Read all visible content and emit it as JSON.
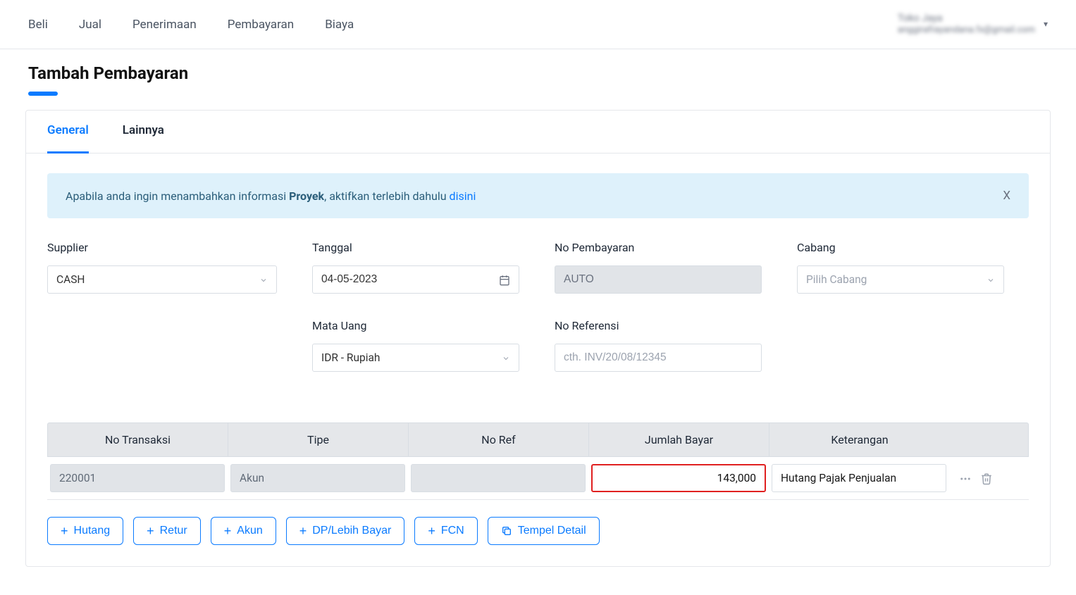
{
  "nav": {
    "items": [
      "Beli",
      "Jual",
      "Penerimaan",
      "Pembayaran",
      "Biaya"
    ]
  },
  "profile": {
    "line1": "Toko Jaya",
    "line2": "anggirafrayandana.fx@gmail.com"
  },
  "page": {
    "title": "Tambah Pembayaran"
  },
  "tabs": {
    "general": "General",
    "other": "Lainnya"
  },
  "banner": {
    "text_pre": "Apabila anda ingin menambahkan informasi ",
    "bold": "Proyek",
    "text_mid": ", aktifkan terlebih dahulu ",
    "link": "disini"
  },
  "form": {
    "supplier": {
      "label": "Supplier",
      "value": "CASH"
    },
    "tanggal": {
      "label": "Tanggal",
      "value": "04-05-2023"
    },
    "no_pembayaran": {
      "label": "No Pembayaran",
      "value": "AUTO"
    },
    "cabang": {
      "label": "Cabang",
      "placeholder": "Pilih Cabang"
    },
    "mata_uang": {
      "label": "Mata Uang",
      "value": "IDR - Rupiah"
    },
    "no_referensi": {
      "label": "No Referensi",
      "placeholder": "cth. INV/20/08/12345"
    }
  },
  "table": {
    "headers": {
      "no_transaksi": "No Transaksi",
      "tipe": "Tipe",
      "no_ref": "No Ref",
      "jumlah_bayar": "Jumlah Bayar",
      "keterangan": "Keterangan"
    },
    "row": {
      "no_transaksi": "220001",
      "tipe": "Akun",
      "no_ref": "",
      "jumlah_bayar": "143,000",
      "keterangan": "Hutang Pajak Penjualan"
    }
  },
  "buttons": {
    "hutang": "Hutang",
    "retur": "Retur",
    "akun": "Akun",
    "dp": "DP/Lebih Bayar",
    "fcn": "FCN",
    "tempel": "Tempel Detail"
  }
}
